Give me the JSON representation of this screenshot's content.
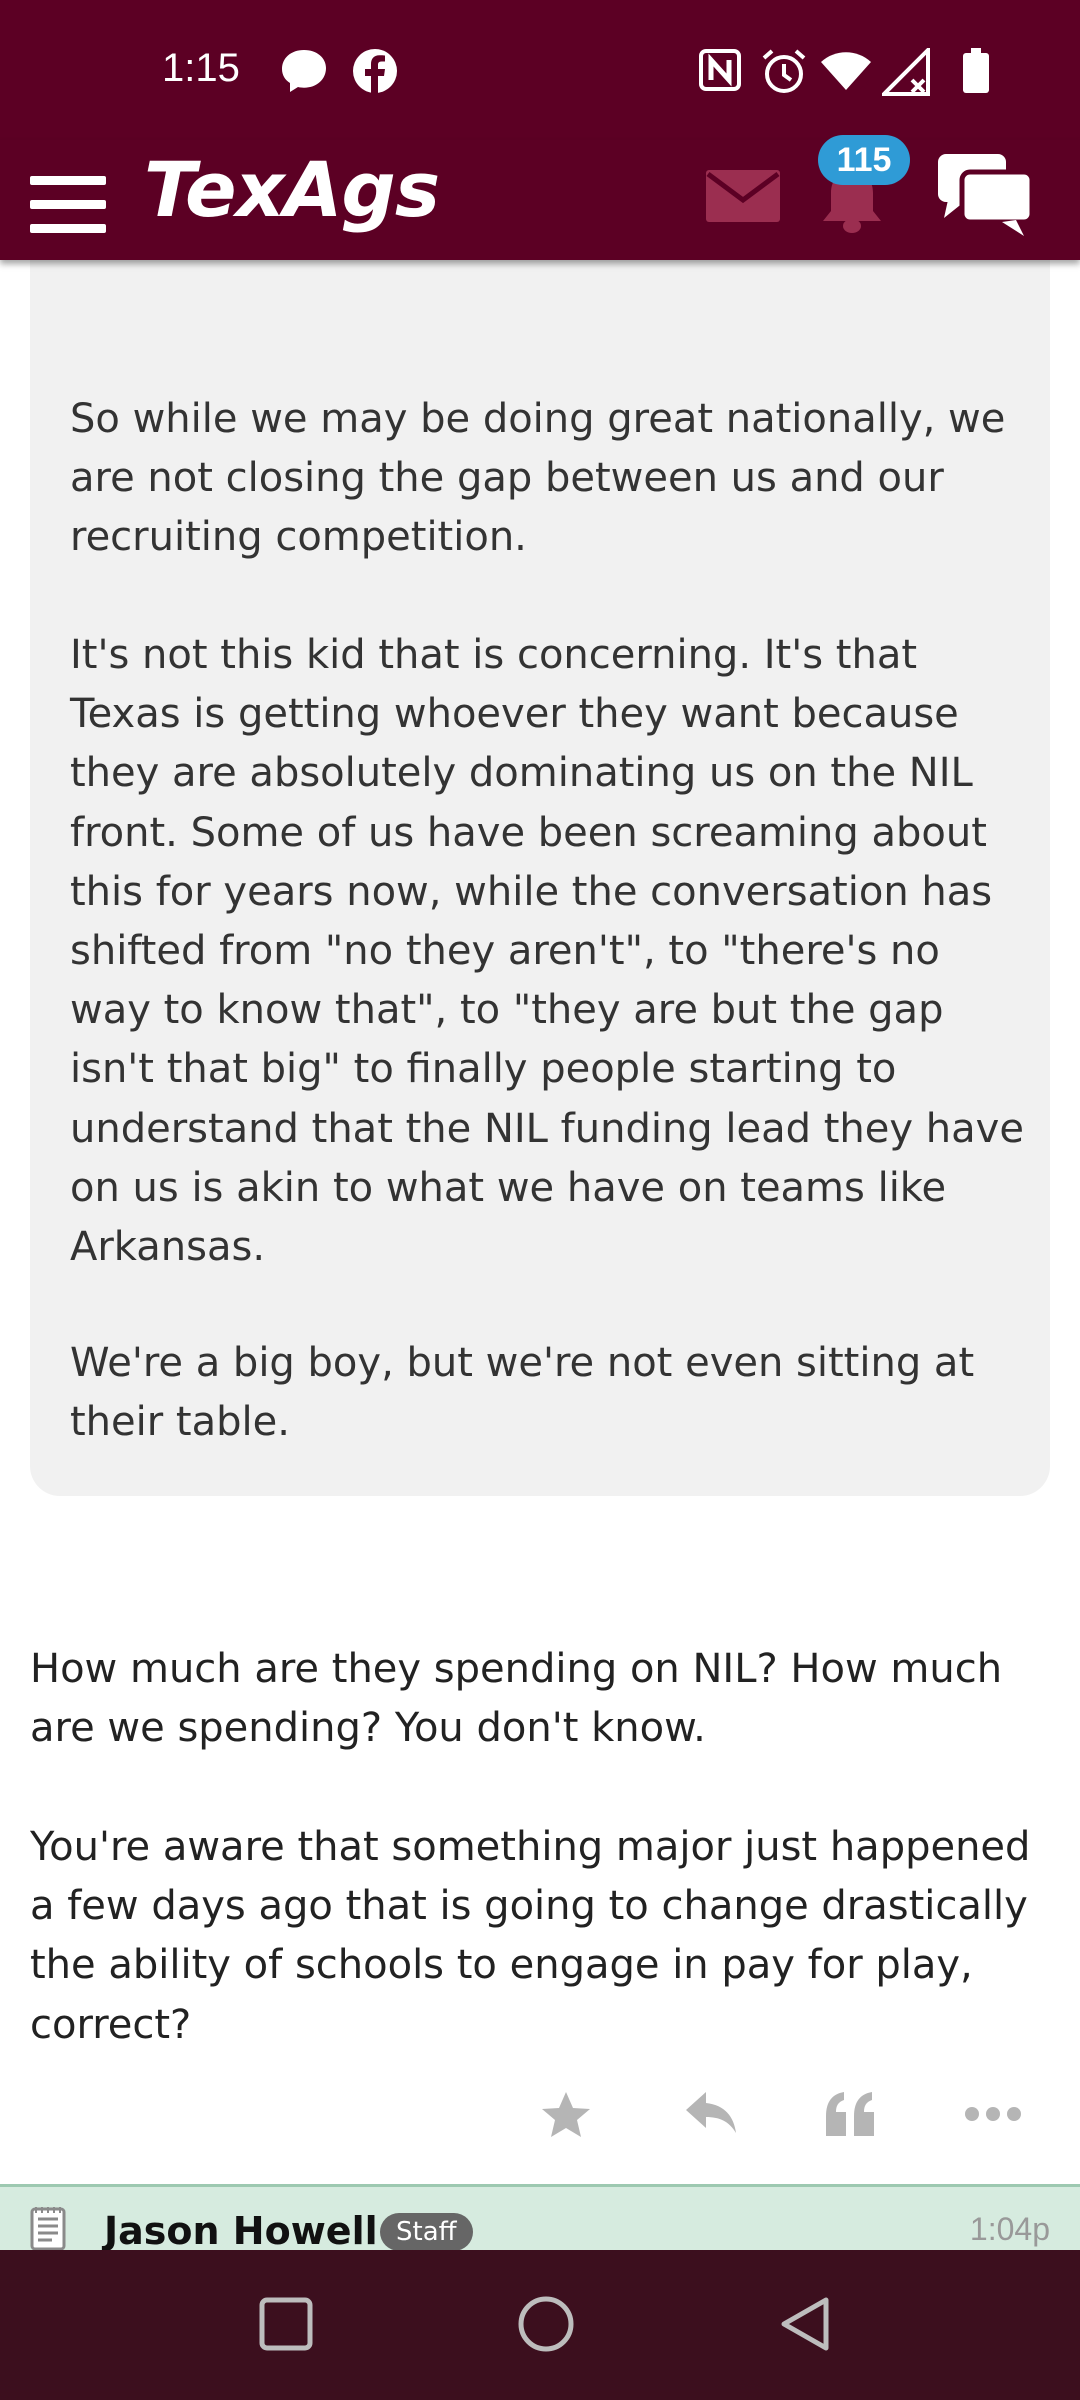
{
  "status_bar": {
    "time": "1:15",
    "left_icons": [
      "messenger-icon",
      "facebook-icon"
    ],
    "right_icons": [
      "nfc-icon",
      "alarm-icon",
      "wifi-icon",
      "signal-icon",
      "battery-icon"
    ]
  },
  "header": {
    "logo": "TexAgs",
    "notification_count": "115",
    "colors": {
      "bar": "#5c0024",
      "badge": "#2f9bd6"
    }
  },
  "quote": {
    "paragraphs": [
      "So while we may be doing great nationally, we are not closing the gap between us and our recruiting competition.",
      "It's not this kid that is concerning. It's that Texas is getting whoever they want because they are absolutely dominating us on the NIL front. Some of us have been screaming about this for years now, while the conversation has shifted from \"no they aren't\", to \"there's no way to know that\", to \"they are but the gap isn't that big\" to finally people starting to understand that the NIL funding lead they have on us is akin to what we have on teams like Arkansas.",
      "We're a big boy, but we're not even sitting at their table."
    ]
  },
  "reply": {
    "paragraphs": [
      "How much are they spending on NIL? How much are we spending? You don't know.",
      "You're aware that something major just happened a few days ago that is going to change drastically the ability of schools to engage in pay for play, correct?"
    ]
  },
  "actions": [
    "star-icon",
    "reply-icon",
    "quote-icon",
    "more-icon"
  ],
  "next_post": {
    "author": "Jason Howell",
    "badge": "Staff",
    "time": "1:04p"
  },
  "nav": [
    "recents-button",
    "home-button",
    "back-button"
  ]
}
